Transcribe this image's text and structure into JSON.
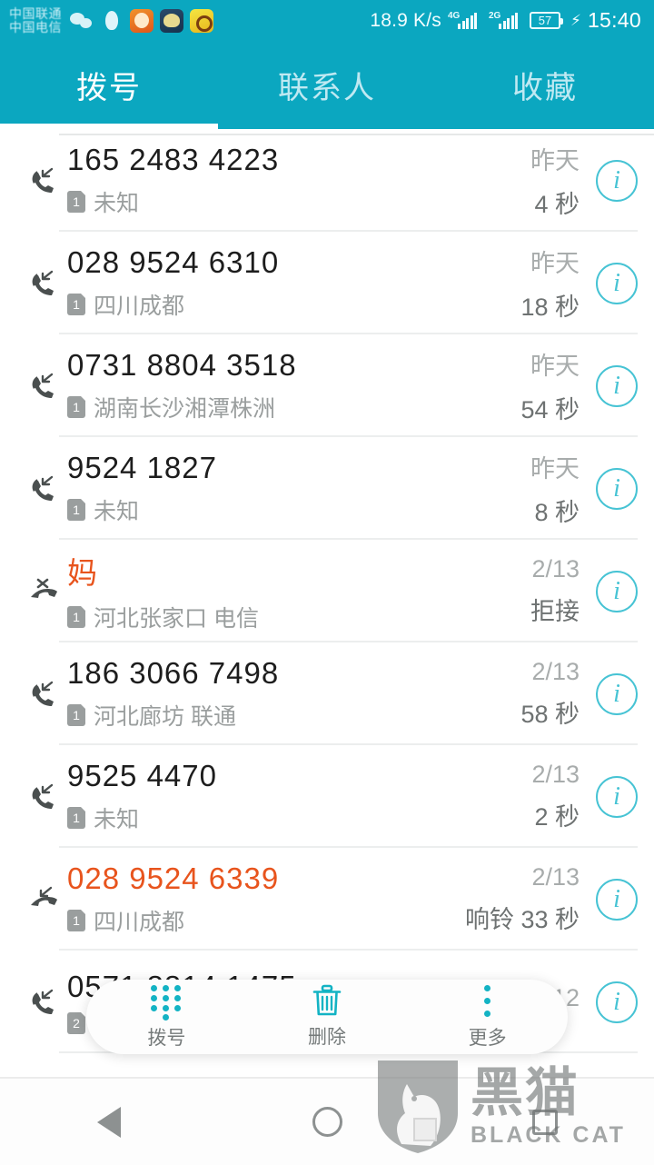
{
  "status_bar": {
    "carrier_line1": "中国联通",
    "carrier_line2": "中国电信",
    "app_icons": [
      "wechat-icon",
      "qq-icon",
      "app-icon-1",
      "app-icon-2",
      "weibo-icon"
    ],
    "network_speed": "18.9 K/s",
    "signal1_label": "4G",
    "signal2_label": "2G",
    "battery_level": "57",
    "charging": "⚡",
    "time": "15:40"
  },
  "tabs": [
    {
      "label": "拨号",
      "active": true
    },
    {
      "label": "联系人",
      "active": false
    },
    {
      "label": "收藏",
      "active": false
    }
  ],
  "call_log": [
    {
      "number": "165 2483 4223",
      "sim": "1",
      "location": "未知",
      "date": "昨天",
      "duration": "4 秒",
      "type": "incoming",
      "missed": false
    },
    {
      "number": "028 9524 6310",
      "sim": "1",
      "location": "四川成都",
      "date": "昨天",
      "duration": "18 秒",
      "type": "incoming",
      "missed": false
    },
    {
      "number": "0731 8804 3518",
      "sim": "1",
      "location": "湖南长沙湘潭株洲",
      "date": "昨天",
      "duration": "54 秒",
      "type": "incoming",
      "missed": false
    },
    {
      "number": "9524 1827",
      "sim": "1",
      "location": "未知",
      "date": "昨天",
      "duration": "8 秒",
      "type": "incoming",
      "missed": false
    },
    {
      "number": "妈",
      "sim": "1",
      "location": "河北张家口 电信",
      "date": "2/13",
      "duration": "拒接",
      "type": "rejected",
      "missed": true
    },
    {
      "number": "186 3066 7498",
      "sim": "1",
      "location": "河北廊坊 联通",
      "date": "2/13",
      "duration": "58 秒",
      "type": "incoming",
      "missed": false
    },
    {
      "number": "9525 4470",
      "sim": "1",
      "location": "未知",
      "date": "2/13",
      "duration": "2 秒",
      "type": "incoming",
      "missed": false
    },
    {
      "number": "028 9524 6339",
      "sim": "1",
      "location": "四川成都",
      "date": "2/13",
      "duration": "响铃 33 秒",
      "type": "missed",
      "missed": true
    },
    {
      "number": "0571 8814 1475",
      "sim": "2",
      "location": "",
      "date": "2/12",
      "duration": "",
      "type": "incoming",
      "missed": false
    }
  ],
  "bottom_bar": [
    {
      "label": "拨号",
      "icon": "dialpad-icon"
    },
    {
      "label": "删除",
      "icon": "trash-icon"
    },
    {
      "label": "更多",
      "icon": "more-vertical-icon"
    }
  ],
  "nav_bar": [
    "back-icon",
    "home-icon",
    "recents-icon"
  ],
  "watermark": {
    "cn": "黑猫",
    "en": "BLACK CAT"
  },
  "colors": {
    "accent": "#0ba7c0",
    "info": "#46c3d4",
    "missed": "#e8541d",
    "muted": "#9a9e9e"
  }
}
